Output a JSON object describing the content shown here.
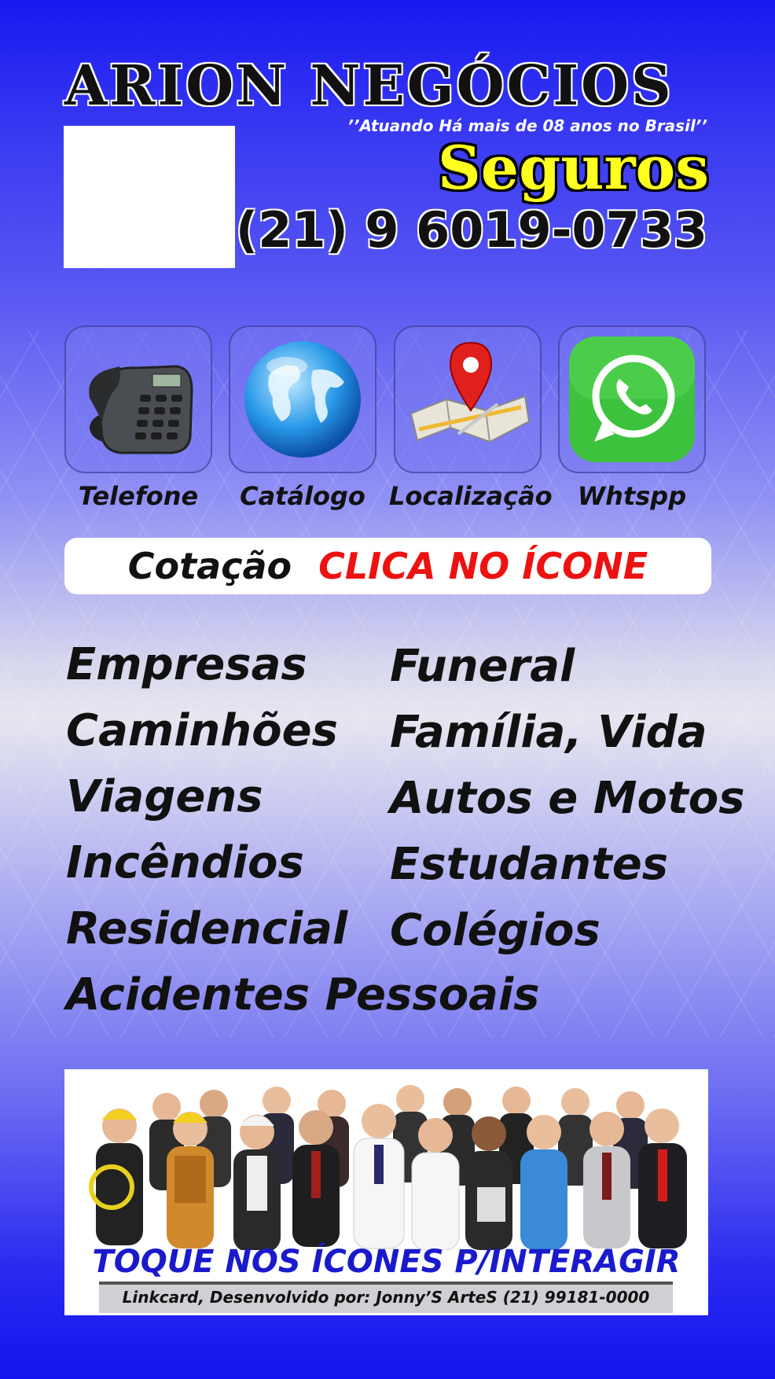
{
  "header": {
    "brand": "ARION NEGÓCIOS",
    "tagline": "’’Atuando Há mais de 08 anos no Brasil’’",
    "subtitle": "Seguros",
    "phone": "(21) 9 6019-0733"
  },
  "icons": [
    {
      "label": "Telefone",
      "icon": "telephone-icon"
    },
    {
      "label": "Catálogo",
      "icon": "globe-icon"
    },
    {
      "label": "Localização",
      "icon": "map-pin-icon"
    },
    {
      "label": "Whtspp",
      "icon": "whatsapp-icon"
    }
  ],
  "cta": {
    "prefix": "Cotação",
    "action": "CLICA NO ÍCONE"
  },
  "services": {
    "left": [
      "Empresas",
      "Caminhões",
      "Viagens",
      "Incêndios",
      "Residencial"
    ],
    "right": [
      "Funeral",
      "Família, Vida",
      "Autos e Motos",
      "Estudantes",
      "Colégios"
    ],
    "full": "Acidentes Pessoais"
  },
  "banner": {
    "cta": "TOQUE NOS ÍCONES P/INTERAGIR",
    "credit": "Linkcard, Desenvolvido por: Jonny’S ArteS (21) 99181-0000"
  },
  "colors": {
    "accent_red": "#ee1111",
    "accent_yellow": "#ffff20",
    "banner_blue": "#1a1acc",
    "whatsapp_green": "#3cc23c"
  }
}
